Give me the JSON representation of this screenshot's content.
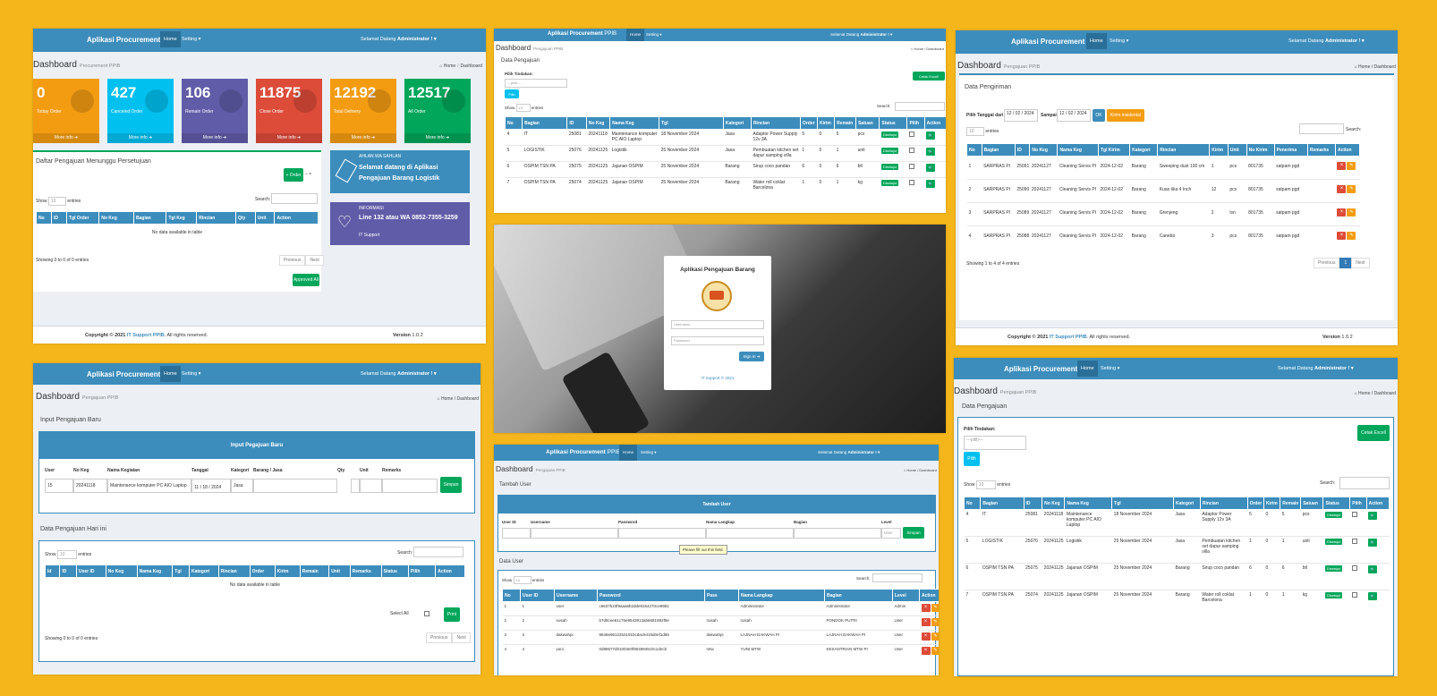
{
  "nav": {
    "brand_bold": "Aplikasi Procurement",
    "brand_thin": "PPIB",
    "home": "Home",
    "setting": "Setting ▾",
    "welcome": "Selamat Datang",
    "user": "Administrator ! ▾"
  },
  "common": {
    "breadcrumb_home": "Home",
    "breadcrumb_dash": "Dashboard",
    "show": "Show",
    "entries": "entries",
    "search": "Search:",
    "previous": "Previous",
    "next": "Next",
    "copyright": "Copyright © 2021",
    "it_support": "IT Support PPIB",
    "rights": ". All rights reserved.",
    "version_label": "Version",
    "version": "1.0.2",
    "pilih_tindakan": "Pilih Tindakan:",
    "pilih_placeholder": "---pilih---",
    "pilih_btn": "Pilih",
    "cetak": "Cetak Excell",
    "show10": "10"
  },
  "p1": {
    "title": "Dashboard",
    "subtitle": "Procurement PPIB",
    "stats": [
      {
        "value": "0",
        "label": "Today Order",
        "more": "More info",
        "color": "#f39c12"
      },
      {
        "value": "427",
        "label": "Canceled Order",
        "more": "More info",
        "color": "#00c0ef"
      },
      {
        "value": "106",
        "label": "Remain Order",
        "more": "More info",
        "color": "#605ca8"
      },
      {
        "value": "11875",
        "label": "Close Order",
        "more": "More info",
        "color": "#dd4b39"
      },
      {
        "value": "12192",
        "label": "Total Delivery",
        "more": "More info",
        "color": "#f39c12"
      },
      {
        "value": "12517",
        "label": "All Order",
        "more": "More info",
        "color": "#00a65a"
      }
    ],
    "box_title": "Daftar Pengajuan Menunggu Persetujuan",
    "order_btn": "+ Order",
    "cols": [
      "No",
      "ID",
      "Tgl Order",
      "No Keg",
      "Bagian",
      "Tgl Keg",
      "Rincian",
      "Qty",
      "Unit",
      "Action"
    ],
    "empty": "No data available in table",
    "showing": "Showing 0 to 0 of 0 entries",
    "approve": "Approved All",
    "info1_small": "AHLAN WA SAHLAN",
    "info1_big": "Selamat datang di Aplikasi Pengajuan Barang Logistik",
    "info2_small": "INFORMASI",
    "info2_big": "Line 132 atau WA 0852-7355-3259",
    "info2_foot": "IT Support"
  },
  "p2": {
    "title": "Dashboard",
    "subtitle": "Pengajuan PPIB",
    "box_title": "Data Pengajuan",
    "cols": [
      "No",
      "Bagian",
      "ID",
      "No Keg",
      "Nama Keg",
      "Tgl",
      "Kategori",
      "Rincian",
      "Order",
      "Kirim",
      "Remain",
      "Satuan",
      "Status",
      "Pilih",
      "Action"
    ],
    "rows": [
      [
        "4",
        "IT",
        "25081",
        "20241118",
        "Maintenance komputer PC AIO Laptop",
        "18 November 2024",
        "Jasa",
        "Adaptor Power Supply 12v 3A",
        "5",
        "0",
        "5",
        "pcs"
      ],
      [
        "5",
        "LOGISTIK",
        "25076",
        "20241125",
        "Logistik",
        "25 November 2024",
        "Jasa",
        "Pembuatan kitchen set dapur samping villa",
        "1",
        "0",
        "1",
        "unit"
      ],
      [
        "6",
        "OSPIM TSN PA",
        "25075",
        "20241125",
        "Jajanan OSPIM",
        "25 November 2024",
        "Barang",
        "Sirup coco pandan",
        "6",
        "0",
        "6",
        "btl"
      ],
      [
        "7",
        "OSPIM TSN PA",
        "25074",
        "20241125",
        "Jajanan OSPIM",
        "25 November 2024",
        "Barang",
        "Water roll coklat Barcelona",
        "1",
        "0",
        "1",
        "kg"
      ]
    ],
    "status": "Disetujui"
  },
  "p3": {
    "title": "Dashboard",
    "subtitle": "Pengajuan PPIB",
    "box_title": "Data Pengiriman",
    "filter_label": "Pilih Tanggal dari :",
    "date_from": "12 / 02 / 2024",
    "to_label": "Sampai :",
    "date_to": "12 / 02 / 2024",
    "ok": "OK",
    "insidental": "Kirim insidental",
    "cols": [
      "No",
      "Bagian",
      "ID",
      "No Keg",
      "Nama Keg",
      "Tgl Kirim",
      "Kategori",
      "Rincian",
      "Kirim",
      "Unit",
      "No Kirim",
      "Penerima",
      "Remarks",
      "Action"
    ],
    "rows": [
      [
        "1",
        "SARPRAS PI",
        "25091",
        "20241127",
        "Cleaning Servis PI",
        "2024-12-02",
        "Barang",
        "Sweeping dust 100 cm",
        "1",
        "pcs",
        "801735",
        "satpam pgd"
      ],
      [
        "2",
        "SARPRAS PI",
        "25090",
        "20241127",
        "Cleaning Servis PI",
        "2024-12-02",
        "Barang",
        "Kuas tika 4 Inch",
        "12",
        "pcs",
        "801735",
        "satpam pgd"
      ],
      [
        "3",
        "SARPRAS PI",
        "25089",
        "20241127",
        "Cleaning Servis PI",
        "2024-12-02",
        "Barang",
        "Grenjeng",
        "2",
        "lsn",
        "801735",
        "satpam pgd"
      ],
      [
        "4",
        "SARPRAS PI",
        "25088",
        "20241127",
        "Cleaning Servis PI",
        "2024-12-02",
        "Barang",
        "Canebo",
        "3",
        "pcs",
        "801735",
        "satpam pgd"
      ]
    ],
    "showing": "Showing 1 to 4 of 4 entries",
    "page": "1"
  },
  "login": {
    "title": "Aplikasi Pengajuan Barang",
    "username": "Username",
    "password": "Password",
    "signin": "Sign In ➔",
    "footer": "IT Support © 2021"
  },
  "p4": {
    "title": "Dashboard",
    "subtitle": "Pengajuan PPIB",
    "box_title": "Input Pengajuan Baru",
    "form_header": "Input Pegajuan Baru",
    "labels": [
      "User",
      "No Keg",
      "Nama Kegiatan",
      "Tanggal",
      "Kategori",
      "Barang / Jasa",
      "Qty",
      "Unit",
      "Remarks"
    ],
    "values": {
      "user": "15",
      "nokeg": "20241118",
      "nama": "Maintenance komputer PC AIO Laptop",
      "tanggal": "11 / 18 / 2024",
      "kategori": "Jasa"
    },
    "simpan": "Simpan",
    "box2_title": "Data Pengajuan Hari ini",
    "cols": [
      "Id",
      "ID",
      "User ID",
      "No Keg",
      "Nama Keg",
      "Tgl",
      "Kategori",
      "Rincian",
      "Order",
      "Kirim",
      "Remain",
      "Unit",
      "Remarks",
      "Status",
      "Pilih",
      "Action"
    ],
    "empty": "No data available in table",
    "select_all": "Select All",
    "print": "Print",
    "showing": "Showing 0 to 0 of 0 entries"
  },
  "p5": {
    "title": "Dashboard",
    "subtitle": "Pengajuan PPIB",
    "box_title": "Tambah User",
    "form_header": "Tambah User",
    "labels": [
      "User ID",
      "Username",
      "Password",
      "Nama Langkap",
      "Bagian",
      "Level"
    ],
    "level_value": "User",
    "simpan": "Simpan",
    "tooltip": "Please fill out this field.",
    "box2_title": "Data User",
    "cols": [
      "No",
      "User ID",
      "Username",
      "Password",
      "Pass",
      "Nama Langkap",
      "Bagian",
      "Level",
      "Action"
    ],
    "rows": [
      [
        "1",
        "1",
        "user",
        "c6637b23f9aaa6b2dde8154270ce8981",
        "",
        "Administrator",
        "Administrator",
        "Admin"
      ],
      [
        "2",
        "2",
        "ruisah",
        "b7d9cee61c75e9543913ab6681892f9e",
        "ruisah",
        "ruisah",
        "PONDOK PUTRI",
        "User"
      ],
      [
        "3",
        "3",
        "dakwahpi",
        "9848e9612253191bcdac9419d0ef1d86",
        "dakwahpi",
        "LAJNAH DAKWAH PI",
        "LAJNAH DAKWAH PI",
        "User"
      ],
      [
        "4",
        "4",
        "yuni",
        "0d98677d01003e0f9048945c0c1decb",
        "mtw",
        "YUNI MTW",
        "KESANTRIAN MTW PI",
        "User"
      ]
    ]
  },
  "p6": {
    "title": "Dashboard",
    "subtitle": "Pengajuan PPIB",
    "box_title": "Data Pengajuan",
    "cols": [
      "No",
      "Bagian",
      "ID",
      "No Keg",
      "Nama Keg",
      "Tgl",
      "Kategori",
      "Rincian",
      "Order",
      "Kirim",
      "Remain",
      "Satuan",
      "Status",
      "Pilih",
      "Action"
    ],
    "rows": [
      [
        "4",
        "IT",
        "25081",
        "20241118",
        "Maintenance komputer PC AIO Laptop",
        "18 November 2024",
        "Jasa",
        "Adaptor Power Supply 12v 3A",
        "5",
        "0",
        "5",
        "pcs"
      ],
      [
        "5",
        "LOGISTIK",
        "25076",
        "20241125",
        "Logistik",
        "25 November 2024",
        "Jasa",
        "Pembuatan kitchen set dapur samping villa",
        "1",
        "0",
        "1",
        "unit"
      ],
      [
        "6",
        "OSPIM TSN PA",
        "25075",
        "20241125",
        "Jajanan OSPIM",
        "25 November 2024",
        "Barang",
        "Sirup coco pandan",
        "6",
        "0",
        "6",
        "btl"
      ],
      [
        "7",
        "OSPIM TSN PA",
        "25074",
        "20241125",
        "Jajanan OSPIM",
        "25 November 2024",
        "Barang",
        "Water roll coklat Barcelona",
        "1",
        "0",
        "1",
        "kg"
      ]
    ],
    "status": "Disetujui"
  }
}
